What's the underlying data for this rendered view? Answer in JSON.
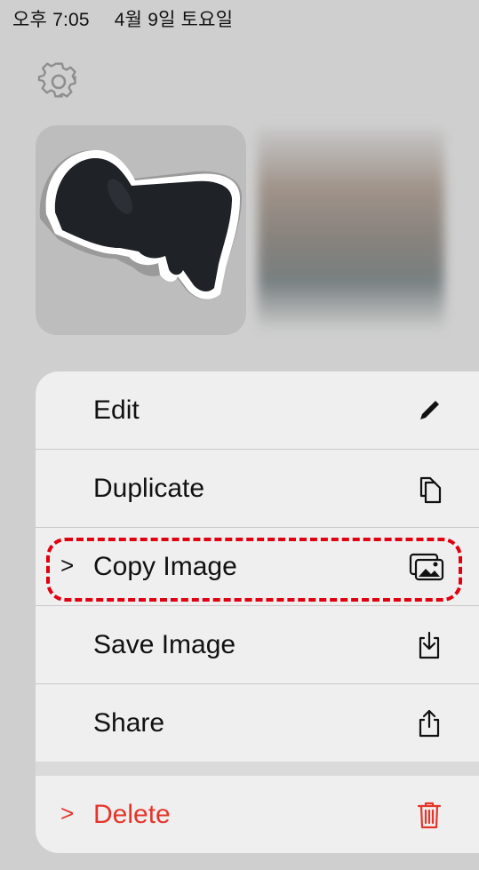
{
  "status_bar": {
    "time": "오후 7:05",
    "date": "4월 9일 토요일"
  },
  "menu": {
    "items": [
      {
        "label": "Edit",
        "icon": "pencil-icon"
      },
      {
        "label": "Duplicate",
        "icon": "duplicate-icon"
      },
      {
        "label": "Copy Image",
        "icon": "photos-icon",
        "submenu": true
      },
      {
        "label": "Save Image",
        "icon": "save-icon"
      },
      {
        "label": "Share",
        "icon": "share-icon"
      }
    ],
    "delete": {
      "label": "Delete",
      "icon": "trash-icon",
      "color": "#e5352b"
    },
    "chevron": ">"
  },
  "colors": {
    "background": "#cfcfcf",
    "menu_bg": "#efefef",
    "destructive": "#e5352b",
    "highlight": "#e00010"
  }
}
